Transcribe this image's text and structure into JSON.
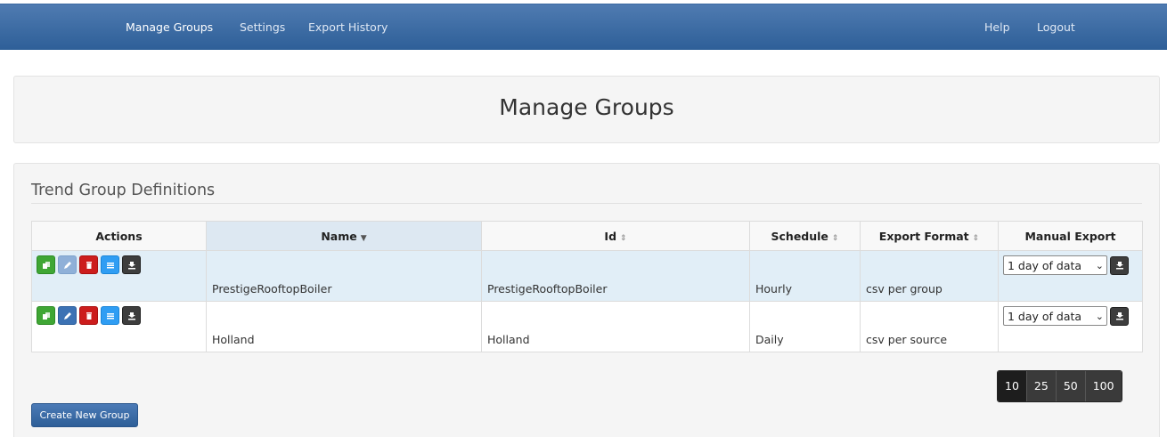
{
  "nav": {
    "left": [
      "Manage Groups",
      "Settings",
      "Export History"
    ],
    "right": [
      "Help",
      "Logout"
    ]
  },
  "header": {
    "title": "Manage Groups"
  },
  "section": {
    "title": "Trend Group Definitions"
  },
  "table": {
    "columns": {
      "actions": "Actions",
      "name": "Name",
      "id": "Id",
      "schedule": "Schedule",
      "format": "Export Format",
      "manual": "Manual Export"
    },
    "sorted_column": "Name",
    "rows": [
      {
        "name": "PrestigeRooftopBoiler",
        "id": "PrestigeRooftopBoiler",
        "schedule": "Hourly",
        "format": "csv per group",
        "range": "1 day of data",
        "selected": true
      },
      {
        "name": "Holland",
        "id": "Holland",
        "schedule": "Daily",
        "format": "csv per source",
        "range": "1 day of data",
        "selected": false
      }
    ],
    "action_icons": [
      "copy-icon",
      "pencil-icon",
      "trash-icon",
      "list-icon",
      "download-icon"
    ]
  },
  "pagination": {
    "sizes": [
      "10",
      "25",
      "50",
      "100"
    ],
    "active": "10"
  },
  "create_button": "Create New Group",
  "colors": {
    "navbar": "#2e5f98",
    "selected_row": "#e1eef7",
    "btn_green": "#3fa634",
    "btn_blue": "#3c72b4",
    "btn_red": "#cc1d1d",
    "btn_sky": "#2f9df3",
    "btn_dark": "#3d3d3d"
  }
}
